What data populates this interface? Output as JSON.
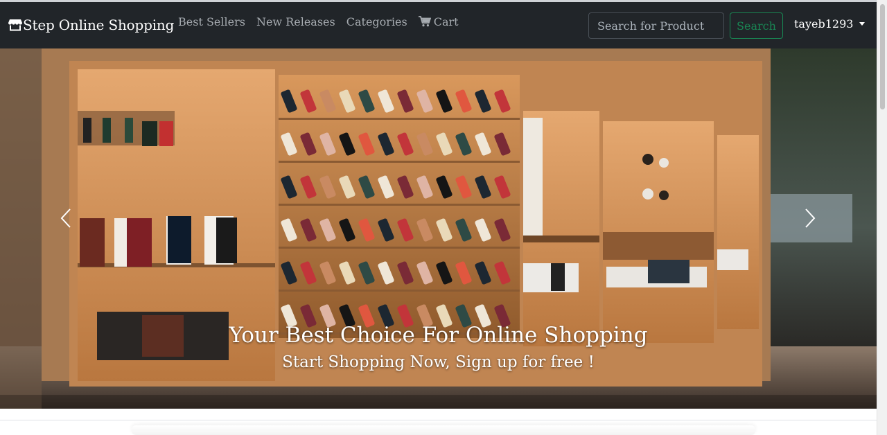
{
  "brand": {
    "name": "Step Online Shopping",
    "icon": "shop-icon"
  },
  "nav": {
    "best_sellers": "Best Sellers",
    "new_releases": "New Releases",
    "categories": "Categories",
    "cart": "Cart",
    "cart_icon": "cart-icon"
  },
  "search": {
    "placeholder": "Search for Product",
    "value": "",
    "button_label": "Search"
  },
  "user": {
    "name": "tayeb1293"
  },
  "hero": {
    "title": "Your Best Choice For Online Shopping",
    "subtitle": "Start Shopping Now, Sign up for free !",
    "prev_icon": "chevron-left-icon",
    "next_icon": "chevron-right-icon"
  },
  "colors": {
    "navbar_bg": "#212529",
    "nav_link": "#a7acb1",
    "search_button": "#198754"
  }
}
